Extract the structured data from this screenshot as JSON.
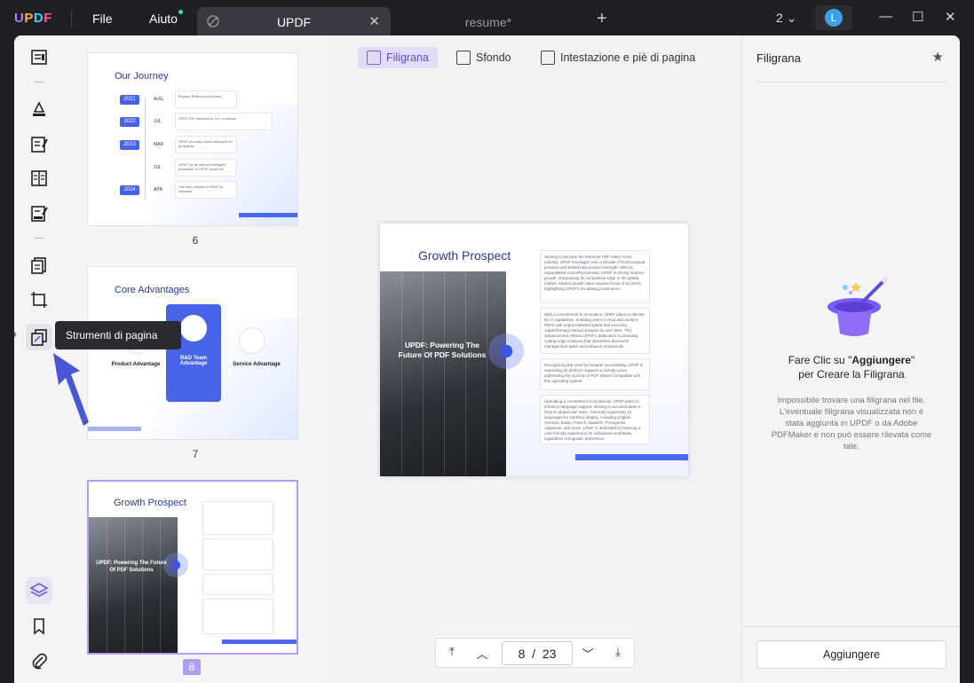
{
  "app": {
    "logo": "UPDF",
    "menus": [
      "File",
      "Aiuto"
    ],
    "tabs": [
      {
        "label": "UPDF",
        "active": true
      },
      {
        "label": "resume*",
        "active": false
      }
    ],
    "window_count": "2",
    "avatar_letter": "L"
  },
  "tooltip": {
    "label": "Strumenti di pagina"
  },
  "thumbnails": [
    {
      "page": "6",
      "title": "Our Journey",
      "timeline": [
        {
          "year": "2021",
          "month": "AUG",
          "text": "Explore Reference the best"
        },
        {
          "year": "2022",
          "month": "JUL",
          "text": "UPDF iOS released in 10+ countries"
        },
        {
          "year": "2023",
          "month": "MAR",
          "text": "UPDF provides plans deployed for prosperity"
        },
        {
          "year": "",
          "month": "JUL",
          "text": "UPDF for as well as intelligent processor in UPDF solutions"
        },
        {
          "year": "2024",
          "month": "APR",
          "text": "The web version of UPDF AI released"
        }
      ]
    },
    {
      "page": "7",
      "title": "Core Advantages",
      "left": "Product Advantage",
      "center": "R&D Team Advantage",
      "right": "Service Advantage"
    },
    {
      "page": "8",
      "title": "Growth Prospect",
      "overlay": "UPDF: Powering The Future Of PDF Solutions",
      "selected": true
    }
  ],
  "toolbar": {
    "filigrana": "Filigrana",
    "sfondo": "Sfondo",
    "intestazione": "Intestazione e piè di pagina"
  },
  "slide": {
    "title": "Growth Prospect",
    "overlay_line1": "UPDF: Powering The",
    "overlay_line2": "Future Of PDF Solutions",
    "cards": [
      "Striving to become the foremost PDF editor in the industry, UPDF leverages over a decade of technological prowess and tested best product strength. With its unparalleled cost-effectiveness, UPDF is driving industry growth, showcasing its competitive edge in the global market. Market growth rates surpass those of its peers, highlighting UPDF's escalating prominence.",
      "With a commitment to innovation, UPDF plans to elevate its AI capabilities, enabling users to read and analyze PDFs with unprecedented speed and accuracy, outperforming manual analysis by over 99%. This advancement reflects UPDF's dedication to providing cutting-edge solutions that streamline document management tasks and enhance productivity.",
      "Recognizing the need for broader accessibility, UPDF is expanding its platform support to include Linux, addressing the scarcity of PDF editors compatible with this operating system.",
      "Upholding a commitment to inclusivity, UPDF plans to enhance language support, striving to accommodate a diverse global user base. Currently supporting 13 languages for interface display, including English, German, Italian, French, Spanish, Portuguese, Japanese, and more, UPDF is dedicated to fostering a user-friendly experience for individuals worldwide, regardless of linguistic preference."
    ]
  },
  "pager": {
    "current": "8",
    "separator": "/",
    "total": "23"
  },
  "right_panel": {
    "title": "Filigrana",
    "main_prefix": "Fare Clic su \"",
    "main_bold": "Aggiungere",
    "main_suffix": "\"",
    "main_line2": "per Creare la Filigrana",
    "sub": "Impossibile trovare una filigrana nel file. L'eventuale filigrana visualizzata non è stata aggiunta in UPDF o da Adobe PDFMaker e non può essere rilevata come tale.",
    "button": "Aggiungere"
  },
  "colors": {
    "accent": "#6449d8",
    "brand_blue": "#4a62e8"
  }
}
